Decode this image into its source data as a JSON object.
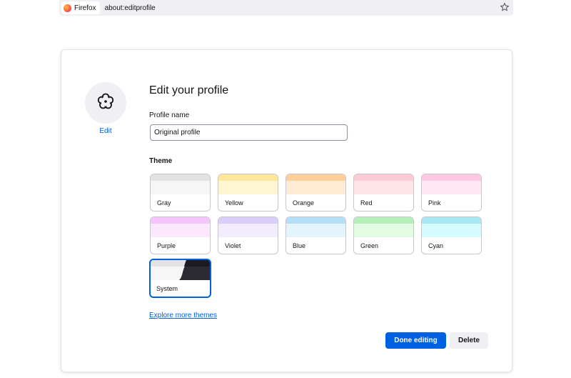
{
  "browser": {
    "identity_label": "Firefox",
    "url": "about:editprofile",
    "bookmark_icon": "star-icon"
  },
  "profile": {
    "avatar_icon": "flower-icon",
    "edit_label": "Edit",
    "title": "Edit your profile",
    "name_label": "Profile name",
    "name_value": "Original profile"
  },
  "theme": {
    "label": "Theme",
    "selected": "System",
    "options": [
      {
        "label": "Gray",
        "band1": "#e3e3e6",
        "band2": "#f6f6f7"
      },
      {
        "label": "Yellow",
        "band1": "#fde79a",
        "band2": "#fff6d2"
      },
      {
        "label": "Orange",
        "band1": "#ffcf99",
        "band2": "#ffead3"
      },
      {
        "label": "Red",
        "band1": "#fcccd4",
        "band2": "#ffe6e6"
      },
      {
        "label": "Pink",
        "band1": "#fdc9e0",
        "band2": "#ffe8f3"
      },
      {
        "label": "Purple",
        "band1": "#f6c5fc",
        "band2": "#fce8fd"
      },
      {
        "label": "Violet",
        "band1": "#d9cdf9",
        "band2": "#f1edfd"
      },
      {
        "label": "Blue",
        "band1": "#b5dff9",
        "band2": "#e4f4fd"
      },
      {
        "label": "Green",
        "band1": "#b7efba",
        "band2": "#e2fce3"
      },
      {
        "label": "Cyan",
        "band1": "#a8e8f2",
        "band2": "#d4fbfd"
      },
      {
        "label": "System",
        "band1": "#f0f0f4",
        "band2": "#f0f0f4"
      }
    ],
    "explore_link": "Explore more themes"
  },
  "actions": {
    "done_label": "Done editing",
    "delete_label": "Delete"
  }
}
